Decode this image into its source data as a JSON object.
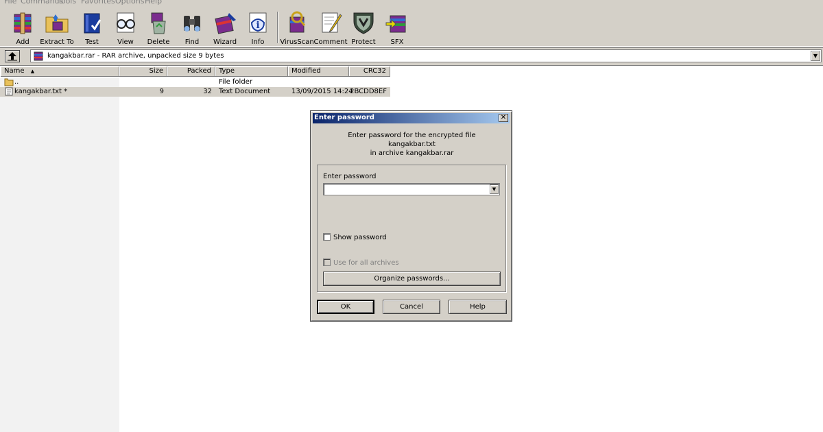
{
  "menu": [
    "File",
    "Commands",
    "Tools",
    "Favorites",
    "Options",
    "Help"
  ],
  "toolbar": {
    "buttons": [
      {
        "label": "Add",
        "icon": "archive-add-icon"
      },
      {
        "label": "Extract To",
        "icon": "extract-folder-icon"
      },
      {
        "label": "Test",
        "icon": "test-book-icon"
      },
      {
        "label": "View",
        "icon": "view-glasses-icon"
      },
      {
        "label": "Delete",
        "icon": "delete-recycle-icon"
      },
      {
        "label": "Find",
        "icon": "find-binoculars-icon"
      },
      {
        "label": "Wizard",
        "icon": "wizard-icon"
      },
      {
        "label": "Info",
        "icon": "info-icon"
      },
      {
        "label": "VirusScan",
        "icon": "virus-scan-icon"
      },
      {
        "label": "Comment",
        "icon": "comment-pen-icon"
      },
      {
        "label": "Protect",
        "icon": "protect-shield-icon"
      },
      {
        "label": "SFX",
        "icon": "sfx-archive-icon"
      }
    ]
  },
  "address": {
    "text": "kangakbar.rar - RAR archive, unpacked size 9 bytes"
  },
  "columns": {
    "name": "Name",
    "size": "Size",
    "packed": "Packed",
    "type": "Type",
    "modified": "Modified",
    "crc": "CRC32"
  },
  "files": [
    {
      "name": "..",
      "size": "",
      "packed": "",
      "type": "File folder",
      "modified": "",
      "crc": ""
    },
    {
      "name": "kangakbar.txt *",
      "size": "9",
      "packed": "32",
      "type": "Text Document",
      "modified": "13/09/2015 14:24",
      "crc": "2BCDD8EF"
    }
  ],
  "dialog": {
    "title": "Enter password",
    "message_line1": "Enter password for the encrypted file",
    "message_line2": "kangakbar.txt",
    "message_line3": "in archive kangakbar.rar",
    "password_label": "Enter password",
    "password_value": "",
    "show_password": "Show password",
    "use_for_all": "Use for all archives",
    "organize": "Organize passwords...",
    "ok": "OK",
    "cancel": "Cancel",
    "help": "Help"
  },
  "colors": {
    "window_bg": "#d4d0c8",
    "title_start": "#0a246a",
    "title_end": "#a6caf0"
  }
}
